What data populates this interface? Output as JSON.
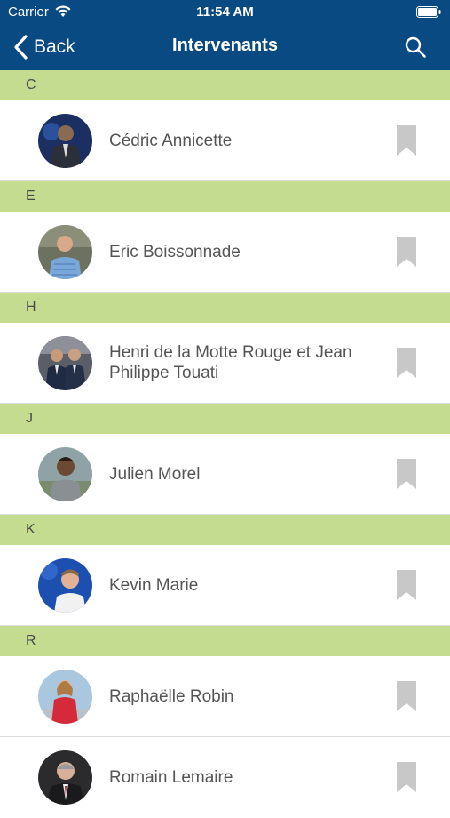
{
  "status_bar": {
    "carrier": "Carrier",
    "time": "11:54 AM"
  },
  "navbar": {
    "back_label": "Back",
    "title": "Intervenants"
  },
  "colors": {
    "navbar_bg": "#0a4a82",
    "section_bg": "#c3dc90",
    "bookmark": "#c8c8c8"
  },
  "sections": [
    {
      "letter": "C",
      "speakers": [
        {
          "name": "Cédric Annicette",
          "bookmark_icon": "bookmark-icon"
        }
      ]
    },
    {
      "letter": "E",
      "speakers": [
        {
          "name": "Eric Boissonnade",
          "bookmark_icon": "bookmark-icon"
        }
      ]
    },
    {
      "letter": "H",
      "speakers": [
        {
          "name": "Henri de la Motte Rouge et Jean Philippe Touati",
          "bookmark_icon": "bookmark-icon"
        }
      ]
    },
    {
      "letter": "J",
      "speakers": [
        {
          "name": "Julien Morel",
          "bookmark_icon": "bookmark-icon"
        }
      ]
    },
    {
      "letter": "K",
      "speakers": [
        {
          "name": "Kevin Marie",
          "bookmark_icon": "bookmark-icon"
        }
      ]
    },
    {
      "letter": "R",
      "speakers": [
        {
          "name": "Raphaëlle Robin",
          "bookmark_icon": "bookmark-icon"
        },
        {
          "name": "Romain Lemaire",
          "bookmark_icon": "bookmark-icon"
        }
      ]
    }
  ]
}
